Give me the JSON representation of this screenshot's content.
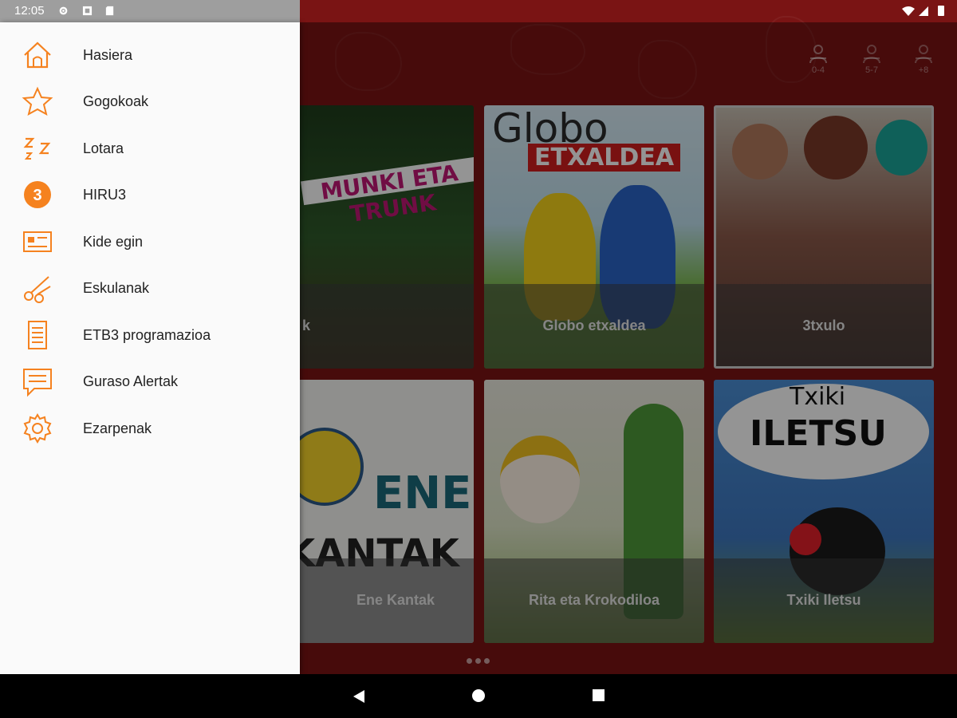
{
  "status_bar": {
    "time": "12:05"
  },
  "age_filters": [
    {
      "label": "0-4"
    },
    {
      "label": "5-7"
    },
    {
      "label": "+8"
    }
  ],
  "drawer": {
    "items": [
      {
        "label": "Hasiera",
        "icon": "home-icon"
      },
      {
        "label": "Gogokoak",
        "icon": "star-icon"
      },
      {
        "label": "Lotara",
        "icon": "sleep-icon"
      },
      {
        "label": "HIRU3",
        "icon": "hiru3-icon"
      },
      {
        "label": "Kide egin",
        "icon": "member-card-icon"
      },
      {
        "label": "Eskulanak",
        "icon": "scissors-icon"
      },
      {
        "label": "ETB3 programazioa",
        "icon": "schedule-icon"
      },
      {
        "label": "Guraso Alertak",
        "icon": "message-icon"
      },
      {
        "label": "Ezarpenak",
        "icon": "gear-icon"
      }
    ]
  },
  "cards": [
    {
      "title": "k",
      "art": "MUNKI ETA TRUNK"
    },
    {
      "title": "Globo etxaldea",
      "art": "Globo",
      "art2": "ETXALDEA"
    },
    {
      "title": "3txulo"
    },
    {
      "title": "Ene Kantak",
      "art": "ENE",
      "art2": "KANTAK"
    },
    {
      "title": "Rita eta Krokodiloa"
    },
    {
      "title": "Txiki Iletsu",
      "art": "Txiki",
      "art2": "ILETSU"
    }
  ],
  "colors": {
    "accent": "#f5821f",
    "background": "#7a1414",
    "drawer": "#fafafa"
  }
}
